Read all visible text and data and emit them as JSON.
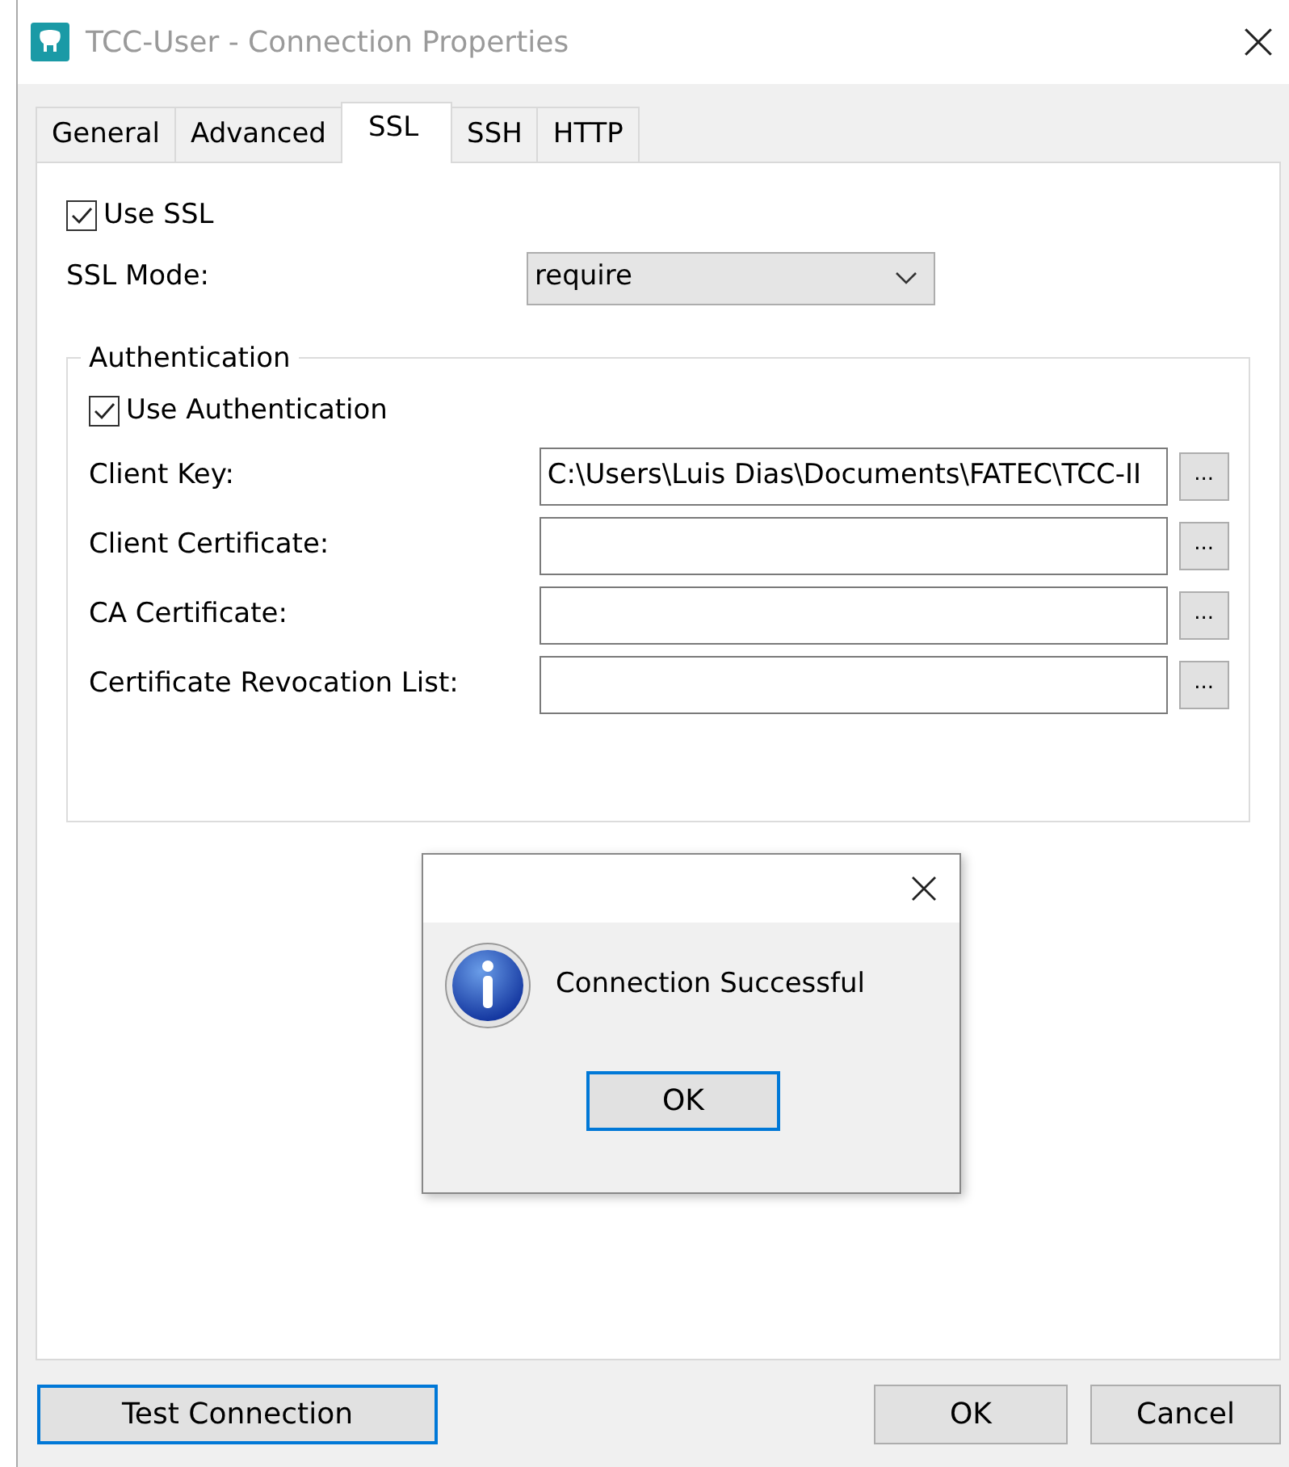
{
  "window": {
    "title": "TCC-User - Connection Properties"
  },
  "tabs": [
    {
      "label": "General",
      "selected": false
    },
    {
      "label": "Advanced",
      "selected": false
    },
    {
      "label": "SSL",
      "selected": true
    },
    {
      "label": "SSH",
      "selected": false
    },
    {
      "label": "HTTP",
      "selected": false
    }
  ],
  "use_ssl": {
    "label": "Use SSL",
    "checked": true
  },
  "ssl_mode": {
    "label": "SSL Mode:",
    "value": "require"
  },
  "authentication": {
    "title": "Authentication",
    "use_authentication": {
      "label": "Use Authentication",
      "checked": true
    },
    "fields": [
      {
        "label": "Client Key:",
        "value": "C:\\Users\\Luis Dias\\Documents\\FATEC\\TCC-II",
        "browse": "..."
      },
      {
        "label": "Client Certificate:",
        "browse": "..."
      },
      {
        "label": "CA Certificate:",
        "browse": "..."
      },
      {
        "label": "Certificate Revocation List:",
        "browse": "..."
      }
    ]
  },
  "message_box": {
    "text": "Connection Successful",
    "button": {
      "label": "OK",
      "focused": true
    }
  },
  "test_button": {
    "label": "Test Connection",
    "focused": true
  },
  "buttons": [
    {
      "label": "OK",
      "focused": false
    },
    {
      "label": "Cancel",
      "focused": false
    }
  ]
}
